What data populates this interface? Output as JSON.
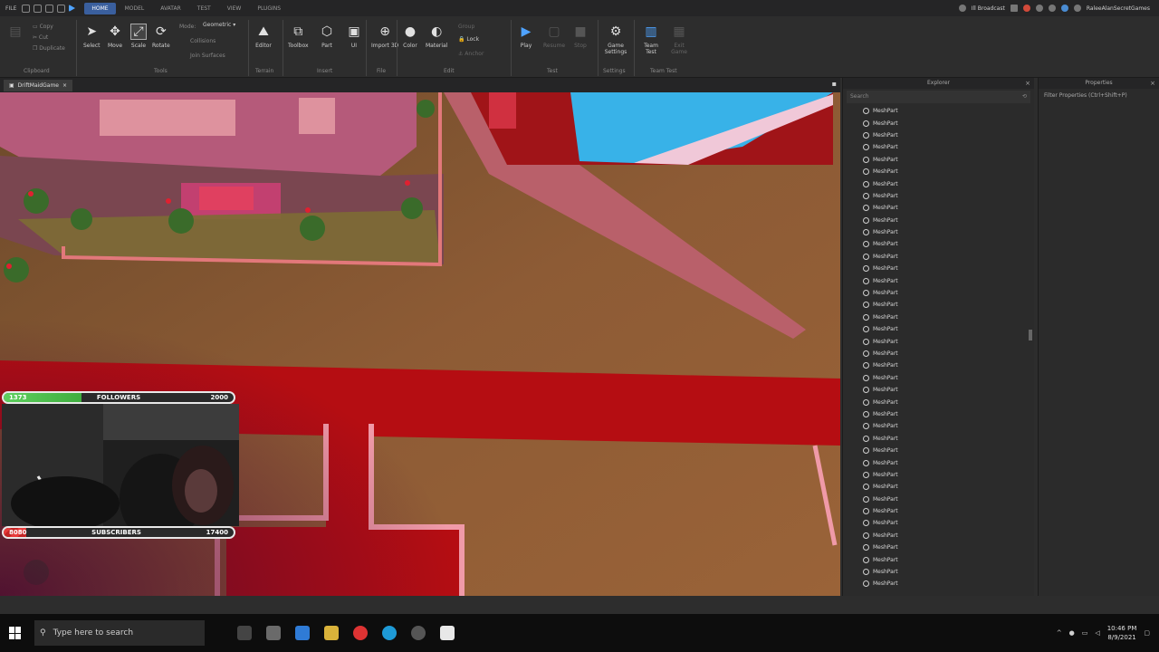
{
  "menubar": {
    "file": "FILE",
    "tabs": [
      "HOME",
      "MODEL",
      "AVATAR",
      "TEST",
      "VIEW",
      "PLUGINS"
    ],
    "active_tab": "HOME",
    "user": "Ill Broadcast",
    "account": "RaleeAlanSecretGames"
  },
  "ribbon": {
    "clipboard_label": "Clipboard",
    "tools": [
      "Select",
      "Move",
      "Scale",
      "Rotate"
    ],
    "tools_label": "Tools",
    "mode_label": "Mode:",
    "mode_value": "Geometric",
    "collisions": "Collisions",
    "join_surfaces": "Join Surfaces",
    "terrain": {
      "editor": "Editor",
      "label": "Terrain"
    },
    "insert": {
      "items": [
        "Toolbox",
        "Part",
        "UI"
      ],
      "label": "Insert"
    },
    "file": {
      "import": "Import 3D",
      "label": "File"
    },
    "edit": {
      "items": [
        "Color",
        "Material"
      ],
      "lock": "Lock",
      "anchor": "Anchor",
      "group": "Group",
      "label": "Edit"
    },
    "test": {
      "play": "Play",
      "resume": "Resume",
      "stop": "Stop",
      "label": "Test"
    },
    "settings": {
      "game": "Game Settings",
      "label": "Settings"
    },
    "team_test": {
      "item": "Team Test",
      "exit": "Exit Game",
      "label": "Team Test"
    }
  },
  "doc_tab": "DriftMaidGame",
  "overlay": {
    "followers_current": "1373",
    "followers_label": "FOLLOWERS",
    "followers_goal": "2000",
    "followers_progress": 0.34,
    "subs_current": "8080",
    "subs_label": "SUBSCRIBERS",
    "subs_goal": "17400",
    "subs_progress": 0.1
  },
  "explorer": {
    "title": "Explorer",
    "search_placeholder": "Search",
    "items": [
      "MeshPart",
      "MeshPart",
      "MeshPart",
      "MeshPart",
      "MeshPart",
      "MeshPart",
      "MeshPart",
      "MeshPart",
      "MeshPart",
      "MeshPart",
      "MeshPart",
      "MeshPart",
      "MeshPart",
      "MeshPart",
      "MeshPart",
      "MeshPart",
      "MeshPart",
      "MeshPart",
      "MeshPart",
      "MeshPart",
      "MeshPart",
      "MeshPart",
      "MeshPart",
      "MeshPart",
      "MeshPart",
      "MeshPart",
      "MeshPart",
      "MeshPart",
      "MeshPart",
      "MeshPart",
      "MeshPart",
      "MeshPart",
      "MeshPart",
      "MeshPart",
      "MeshPart",
      "MeshPart",
      "MeshPart",
      "MeshPart",
      "MeshPart",
      "MeshPart"
    ]
  },
  "properties": {
    "title": "Properties",
    "filter_placeholder": "Filter Properties (Ctrl+Shift+P)"
  },
  "taskbar": {
    "search_placeholder": "Type here to search",
    "time": "10:46 PM",
    "date": "8/9/2021"
  },
  "colors": {
    "accent": "#3a5f9e",
    "followers_fill": "#4fbf4f",
    "subs_fill": "#d62f2f",
    "carpet": "#b50d12",
    "floor": "#8b5a35"
  }
}
